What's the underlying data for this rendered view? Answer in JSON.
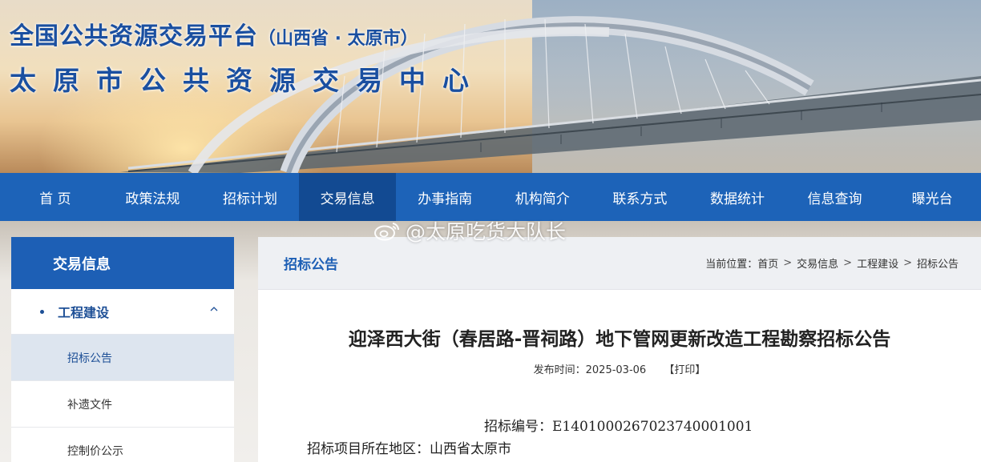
{
  "banner": {
    "platform_title": "全国公共资源交易平台",
    "platform_region": "（山西省 · 太原市）",
    "center_title": "太原市公共资源交易中心"
  },
  "nav": {
    "items": [
      "首 页",
      "政策法规",
      "招标计划",
      "交易信息",
      "办事指南",
      "机构简介",
      "联系方式",
      "数据统计",
      "信息查询",
      "曝光台"
    ],
    "active": "交易信息"
  },
  "sidebar": {
    "header": "交易信息",
    "category": "工程建设",
    "items": [
      "招标公告",
      "补遗文件",
      "控制价公示"
    ],
    "active": "招标公告"
  },
  "main": {
    "section_tag": "招标公告",
    "breadcrumb": {
      "prefix": "当前位置：",
      "items": [
        "首页",
        "交易信息",
        "工程建设",
        "招标公告"
      ],
      "separator": ">"
    },
    "article": {
      "title": "迎泽西大街（春居路-晋祠路）地下管网更新改造工程勘察招标公告",
      "publish_label": "发布时间：",
      "publish_date": "2025-03-06",
      "print_label": "【打印】",
      "lines": [
        "招标编号：E1401000267023740001001",
        "招标项目所在地区：山西省太原市"
      ]
    }
  },
  "watermark": {
    "text": "@太原吃货大队长",
    "icon": "weibo-icon"
  },
  "colors": {
    "nav_bg": "#1d63b8",
    "nav_active": "#124a92",
    "accent_text": "#1d5fb5",
    "sidebar_active_bg": "#dde5ef"
  }
}
